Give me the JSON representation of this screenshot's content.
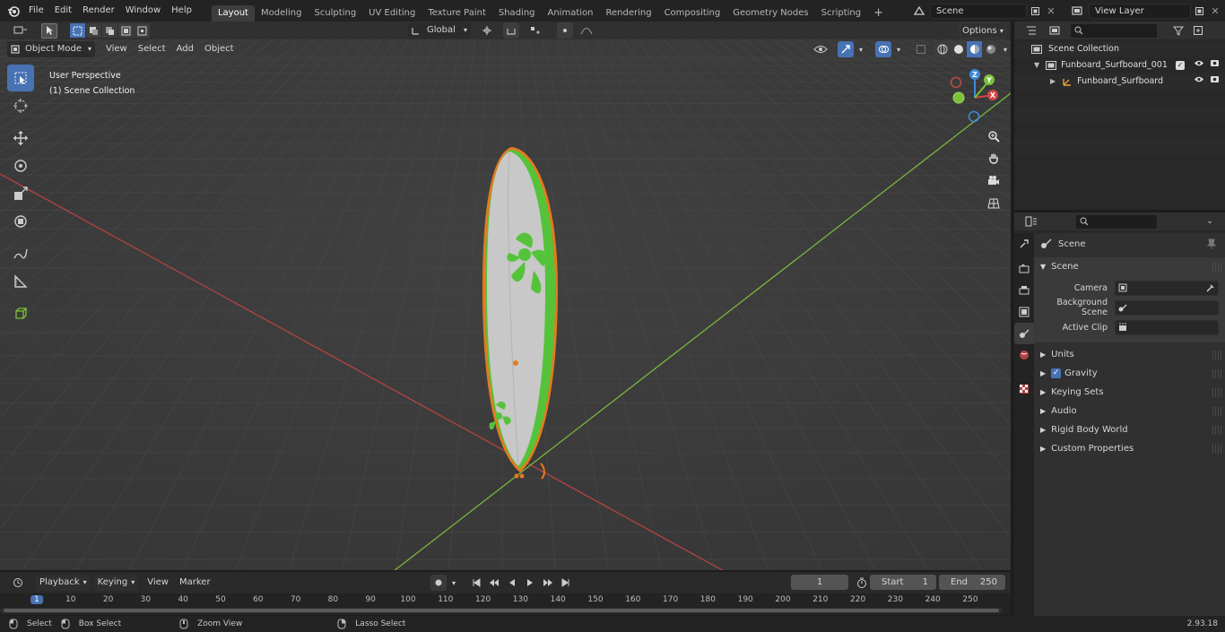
{
  "app": {
    "version": "2.93.18"
  },
  "menu": [
    "File",
    "Edit",
    "Render",
    "Window",
    "Help"
  ],
  "workspaces": [
    "Layout",
    "Modeling",
    "Sculpting",
    "UV Editing",
    "Texture Paint",
    "Shading",
    "Animation",
    "Rendering",
    "Compositing",
    "Geometry Nodes",
    "Scripting"
  ],
  "active_workspace": "Layout",
  "scene_field": "Scene",
  "view_layer_field": "View Layer",
  "viewport": {
    "mode": "Object Mode",
    "menus": [
      "View",
      "Select",
      "Add",
      "Object"
    ],
    "transform_orientation": "Global",
    "options_label": "Options",
    "overlay_title": "User Perspective",
    "overlay_collection": "(1) Scene Collection",
    "gizmo_axes": {
      "x": "X",
      "y": "Y",
      "z": "Z"
    }
  },
  "outliner": {
    "items": [
      {
        "label": "Scene Collection"
      },
      {
        "label": "Funboard_Surfboard_001"
      },
      {
        "label": "Funboard_Surfboard"
      }
    ]
  },
  "properties": {
    "title": "Scene",
    "section": "Scene",
    "fields": [
      {
        "label": "Camera",
        "value": ""
      },
      {
        "label": "Background Scene",
        "value": ""
      },
      {
        "label": "Active Clip",
        "value": ""
      }
    ],
    "panels": [
      "Units",
      "Gravity",
      "Keying Sets",
      "Audio",
      "Rigid Body World",
      "Custom Properties"
    ]
  },
  "timeline": {
    "menus": [
      "Playback",
      "Keying",
      "View",
      "Marker"
    ],
    "current_frame": "1",
    "start_label": "Start",
    "start_value": "1",
    "end_label": "End",
    "end_value": "250",
    "ticks": [
      "1",
      "10",
      "20",
      "30",
      "40",
      "50",
      "60",
      "70",
      "80",
      "90",
      "100",
      "110",
      "120",
      "130",
      "140",
      "150",
      "160",
      "170",
      "180",
      "190",
      "200",
      "210",
      "220",
      "230",
      "240",
      "250"
    ]
  },
  "status": {
    "items": [
      "Select",
      "Box Select",
      "Zoom View",
      "Lasso Select"
    ]
  },
  "colors": {
    "accent": "#4772b3",
    "object_green": "#55c33a",
    "selection_orange": "#e57a1e",
    "x_axis": "#d04545",
    "y_axis": "#7cc13a",
    "z_axis": "#3e8ad9"
  }
}
